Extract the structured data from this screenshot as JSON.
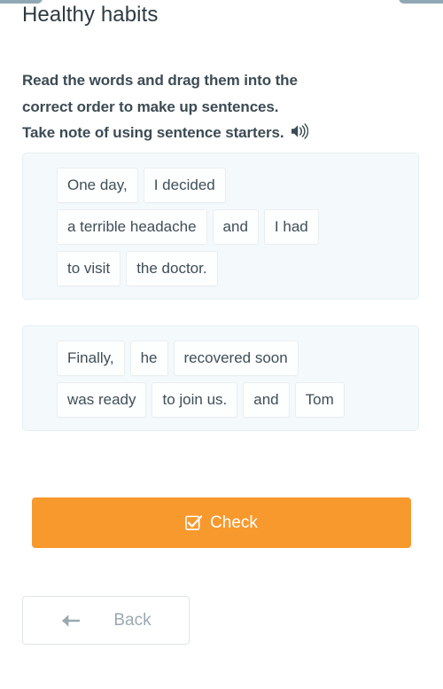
{
  "header": {
    "title": "Healthy habits"
  },
  "decor": {
    "top_bar_color": "#8fa8b4"
  },
  "instruction": {
    "line1": "Read the words and drag them into the",
    "line2": "correct order to make up sentences.",
    "line3": "Take note of using sentence starters.",
    "audio_icon": "speaker-icon"
  },
  "exercise": {
    "groups": [
      {
        "id": "group-1",
        "rows": [
          {
            "chips": [
              "One day,",
              "I decided"
            ]
          },
          {
            "chips": [
              "a terrible headache",
              "and",
              "I had"
            ]
          },
          {
            "chips": [
              "to visit",
              "the doctor."
            ]
          }
        ]
      },
      {
        "id": "group-2",
        "rows": [
          {
            "chips": [
              "Finally,",
              "he",
              "recovered soon"
            ]
          },
          {
            "chips": [
              "was ready",
              "to join us.",
              "and",
              "Tom"
            ]
          }
        ]
      }
    ]
  },
  "actions": {
    "check": {
      "label": "Check",
      "icon": "checkbox-check-icon",
      "color": "#f8992e",
      "text_color": "#ffffff"
    },
    "back": {
      "label": "Back",
      "icon": "arrow-left-icon",
      "text_color": "#9aa9b1"
    }
  },
  "colors": {
    "accent": "#f8992e",
    "group_background": "#f4fafb",
    "group_border": "#e5eff2",
    "chip_border": "#e9eef0",
    "title_text": "#2d3b42",
    "instruction_text": "#3c4b54"
  }
}
